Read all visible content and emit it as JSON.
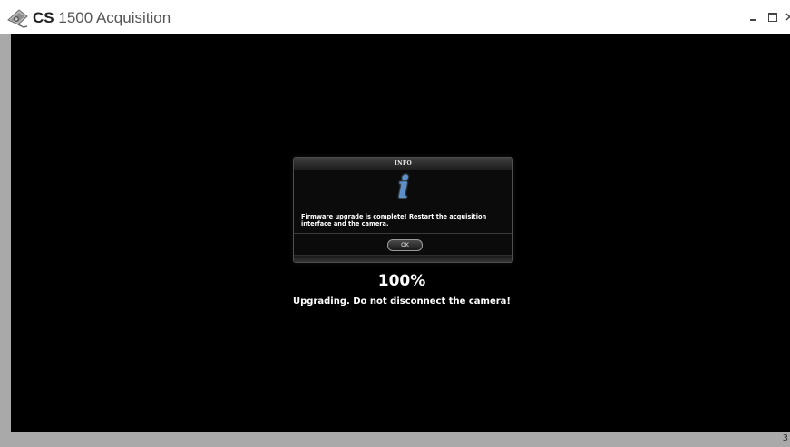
{
  "window": {
    "title_brand": "CS",
    "title_rest": "1500 Acquisition",
    "controls": {
      "minimize": "minimize-icon",
      "maximize": "maximize-icon",
      "close": "close-icon"
    }
  },
  "dialog": {
    "title": "INFO",
    "icon_glyph": "i",
    "icon": "info-icon",
    "message": "Firmware upgrade is complete! Restart the acquisition interface and the camera.",
    "ok_label": "OK"
  },
  "progress": {
    "percent_label": "100%",
    "status": "Upgrading. Do not disconnect the camera!"
  },
  "statusbar": {
    "text": "3"
  },
  "colors": {
    "viewport": "#000000",
    "frame": "#a9a9a9",
    "info_icon": "#5d8fc9"
  }
}
